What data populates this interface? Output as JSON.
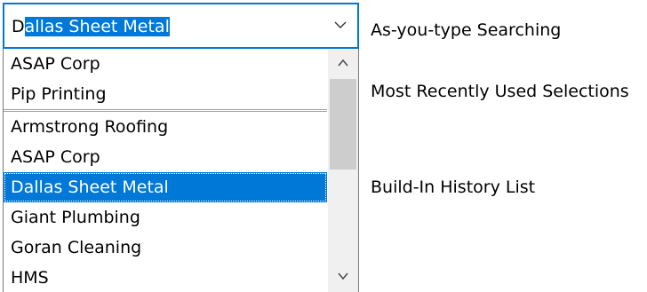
{
  "combo": {
    "typed_text": "D",
    "autocomplete_text": "allas Sheet Metal",
    "chevron_icon": "chevron-down-icon"
  },
  "dropdown": {
    "recent_items": [
      {
        "label": "ASAP Corp"
      },
      {
        "label": "Pip Printing"
      }
    ],
    "items": [
      {
        "label": "Armstrong Roofing"
      },
      {
        "label": "ASAP Corp"
      },
      {
        "label": "Dallas Sheet Metal",
        "selected": true
      },
      {
        "label": "Giant Plumbing"
      },
      {
        "label": "Goran Cleaning"
      },
      {
        "label": "HMS"
      }
    ],
    "selected_label": "Dallas Sheet Metal",
    "scroll_up_icon": "chevron-up-icon",
    "scroll_down_icon": "chevron-down-icon"
  },
  "annotations": {
    "as_you_type": "As-you-type Searching",
    "mru": "Most Recently Used Selections",
    "history": "Build-In History List"
  },
  "colors": {
    "accent": "#0078d7",
    "scroll_track": "#f0f0f0",
    "scroll_thumb": "#cdcdcd"
  }
}
